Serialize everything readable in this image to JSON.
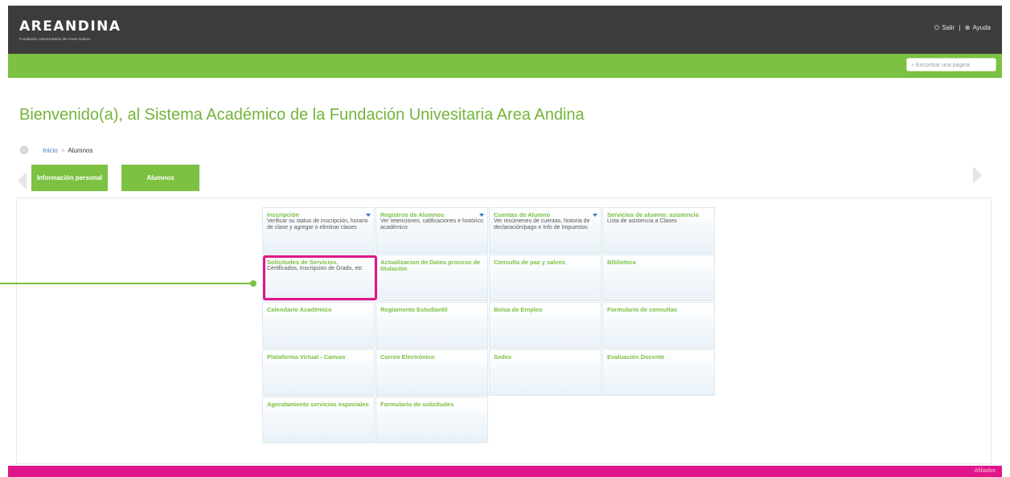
{
  "header": {
    "logo_text": "AREANDINA",
    "logo_subtitle": "Fundación Universitaria del Área Andina",
    "exit_label": "Salir",
    "help_label": "Ayuda",
    "divider": "|",
    "exit_icon": "power-icon",
    "help_icon": "help-icon"
  },
  "search": {
    "placeholder": "Encontrar una página"
  },
  "welcome": "Bienvenido(a), al Sistema Académico de la Fundación Univesitaria Area Andina",
  "breadcrumb": {
    "home": "Inicio",
    "separator": ">",
    "current": "Alumnos"
  },
  "tabs": [
    {
      "label": "Información personal"
    },
    {
      "label": "Alumnos"
    }
  ],
  "menu": [
    {
      "title": "Inscripción",
      "desc": "Verificar su status de inscripción, horario de clase y agregar o eliminar clases",
      "dropdown": true
    },
    {
      "title": "Registros de Alumnos",
      "desc": "Ver retenciones, calificaciones e histórico académico",
      "dropdown": true
    },
    {
      "title": "Cuentas de Alumno",
      "desc": "Ver resúmenes de cuentas, historia de declaración/pago e Info de Impuestos",
      "dropdown": true
    },
    {
      "title": "Servicios de alumno: asistencia",
      "desc": "Lista de asistencia a Clases",
      "dropdown": false
    },
    {
      "title": "Solicitudes de Servicios,",
      "desc": "Certificados, Inscripcion de Grado, etc",
      "dropdown": false
    },
    {
      "title": "Actualizacion de Datos proceso de titulación",
      "desc": "",
      "dropdown": false
    },
    {
      "title": "Consulta de paz y salvos",
      "desc": "",
      "dropdown": false
    },
    {
      "title": "Biblioteca",
      "desc": "",
      "dropdown": false
    },
    {
      "title": "Calendario Académico",
      "desc": "",
      "dropdown": false
    },
    {
      "title": "Reglamento Estudiantil",
      "desc": "",
      "dropdown": false
    },
    {
      "title": "Bolsa de Empleo",
      "desc": "",
      "dropdown": false
    },
    {
      "title": "Formulario de consultas",
      "desc": "",
      "dropdown": false
    },
    {
      "title": "Plataforma Virtual - Canvas",
      "desc": "",
      "dropdown": false
    },
    {
      "title": "Correo Electrónico",
      "desc": "",
      "dropdown": false
    },
    {
      "title": "Sedes",
      "desc": "",
      "dropdown": false
    },
    {
      "title": "Evaluación Docente",
      "desc": "",
      "dropdown": false
    },
    {
      "title": "Agendamiento servicios especiales",
      "desc": "",
      "dropdown": false
    },
    {
      "title": "Formulario de solicitudes",
      "desc": "",
      "dropdown": false
    }
  ],
  "footer": {
    "text": "Afiliados"
  },
  "colors": {
    "green": "#7cc142",
    "pink": "#e0168a",
    "dark": "#3c3c3c"
  }
}
